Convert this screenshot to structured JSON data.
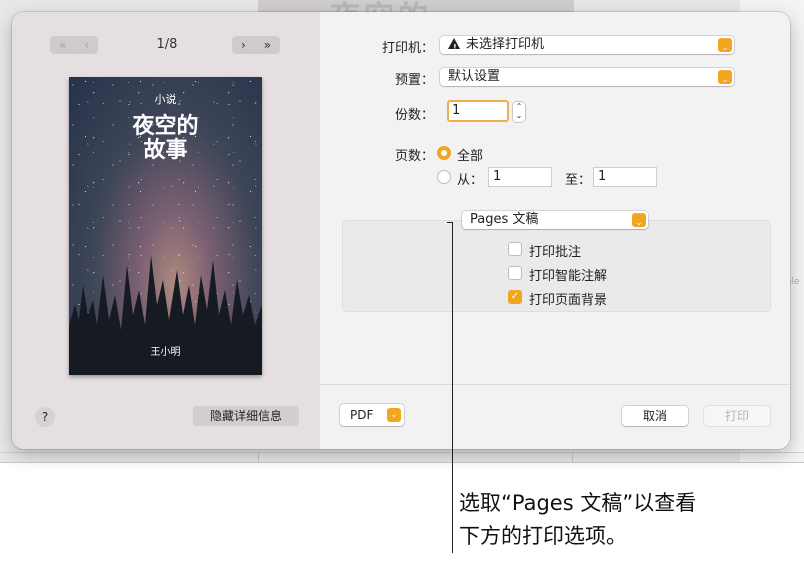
{
  "preview": {
    "page_indicator": "1/8",
    "cover": {
      "kicker": "小说",
      "title_line1": "夜空的",
      "title_line2": "故事",
      "author": "王小明"
    },
    "help_label": "?",
    "hide_details_label": "隐藏详细信息"
  },
  "settings": {
    "printer_label": "打印机：",
    "printer_value": "未选择打印机",
    "presets_label": "预置：",
    "presets_value": "默认设置",
    "copies_label": "份数：",
    "copies_value": "1",
    "pages_label": "页数：",
    "pages_all_label": "全部",
    "pages_from_label": "从：",
    "pages_from_value": "1",
    "pages_to_label": "至：",
    "pages_to_value": "1",
    "section_popup_value": "Pages 文稿",
    "options": [
      {
        "label": "打印批注",
        "checked": false
      },
      {
        "label": "打印智能注解",
        "checked": false
      },
      {
        "label": "打印页面背景",
        "checked": true
      }
    ]
  },
  "footer": {
    "pdf_label": "PDF",
    "cancel_label": "取消",
    "print_label": "打印"
  },
  "callout": {
    "line1": "选取“Pages 文稿”以查看",
    "line2": "下方的打印选项。"
  },
  "background": {
    "doc_title": "夜空的",
    "side_text": "ele"
  },
  "colors": {
    "accent": "#f2a51e",
    "focus_ring": "#f0ad4e"
  },
  "icons": {
    "prev": "chevron-double-left-icon",
    "next": "chevron-right-icon",
    "warning": "warning-icon"
  }
}
